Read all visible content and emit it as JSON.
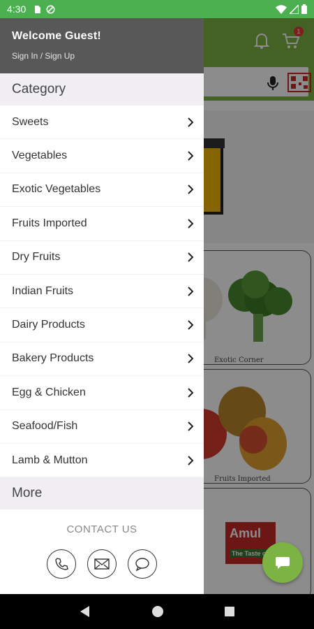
{
  "status_bar": {
    "time": "4:30"
  },
  "app": {
    "cart_count": "1",
    "cards": [
      "Exotic Corner",
      "Fruits Imported"
    ],
    "brand_text": "Amul",
    "brand_tagline": "The Taste o"
  },
  "drawer": {
    "welcome": "Welcome Guest!",
    "signin": "Sign In / Sign Up",
    "category_title": "Category",
    "categories": [
      "Sweets",
      "Vegetables",
      "Exotic Vegetables",
      "Fruits Imported",
      "Dry Fruits",
      "Indian Fruits",
      "Dairy Products",
      "Bakery Products",
      "Egg & Chicken",
      "Seafood/Fish",
      "Lamb & Mutton"
    ],
    "more_title": "More",
    "contact_label": "CONTACT US"
  },
  "colors": {
    "accent": "#7cb342",
    "status_bar": "#4caf50",
    "drawer_header": "#585858",
    "section_bg": "#f1eff4"
  },
  "icons": [
    "phone-icon",
    "mail-icon",
    "chat-icon",
    "bell-icon",
    "cart-icon",
    "mic-icon",
    "qr-icon",
    "chevron-right-icon"
  ]
}
